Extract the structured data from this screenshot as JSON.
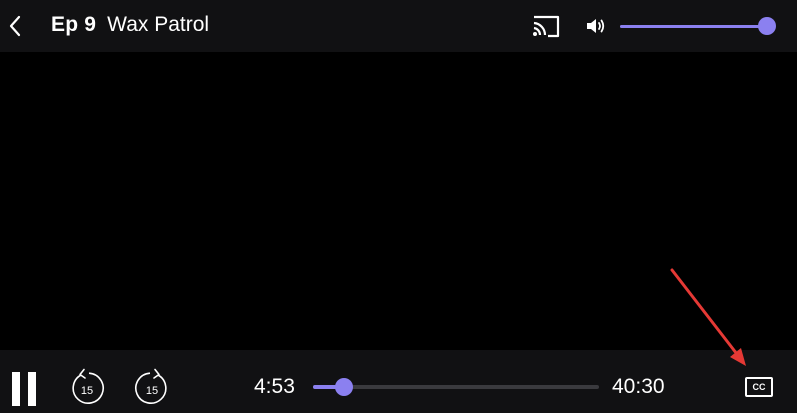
{
  "header": {
    "episode_label": "Ep 9",
    "episode_title": "Wax Patrol",
    "back_icon": "chevron-left-icon",
    "cast_icon": "cast-icon",
    "volume_icon": "volume-icon",
    "volume_level": 0.98
  },
  "controls": {
    "pause_icon": "pause-icon",
    "skip_back_label": "15",
    "skip_forward_label": "15",
    "current_time": "4:53",
    "total_time": "40:30",
    "progress": 0.11,
    "cc_label": "CC"
  },
  "colors": {
    "accent": "#8b80f0",
    "bar_background": "#111113",
    "video_background": "#000000",
    "annotation": "#e53935"
  }
}
